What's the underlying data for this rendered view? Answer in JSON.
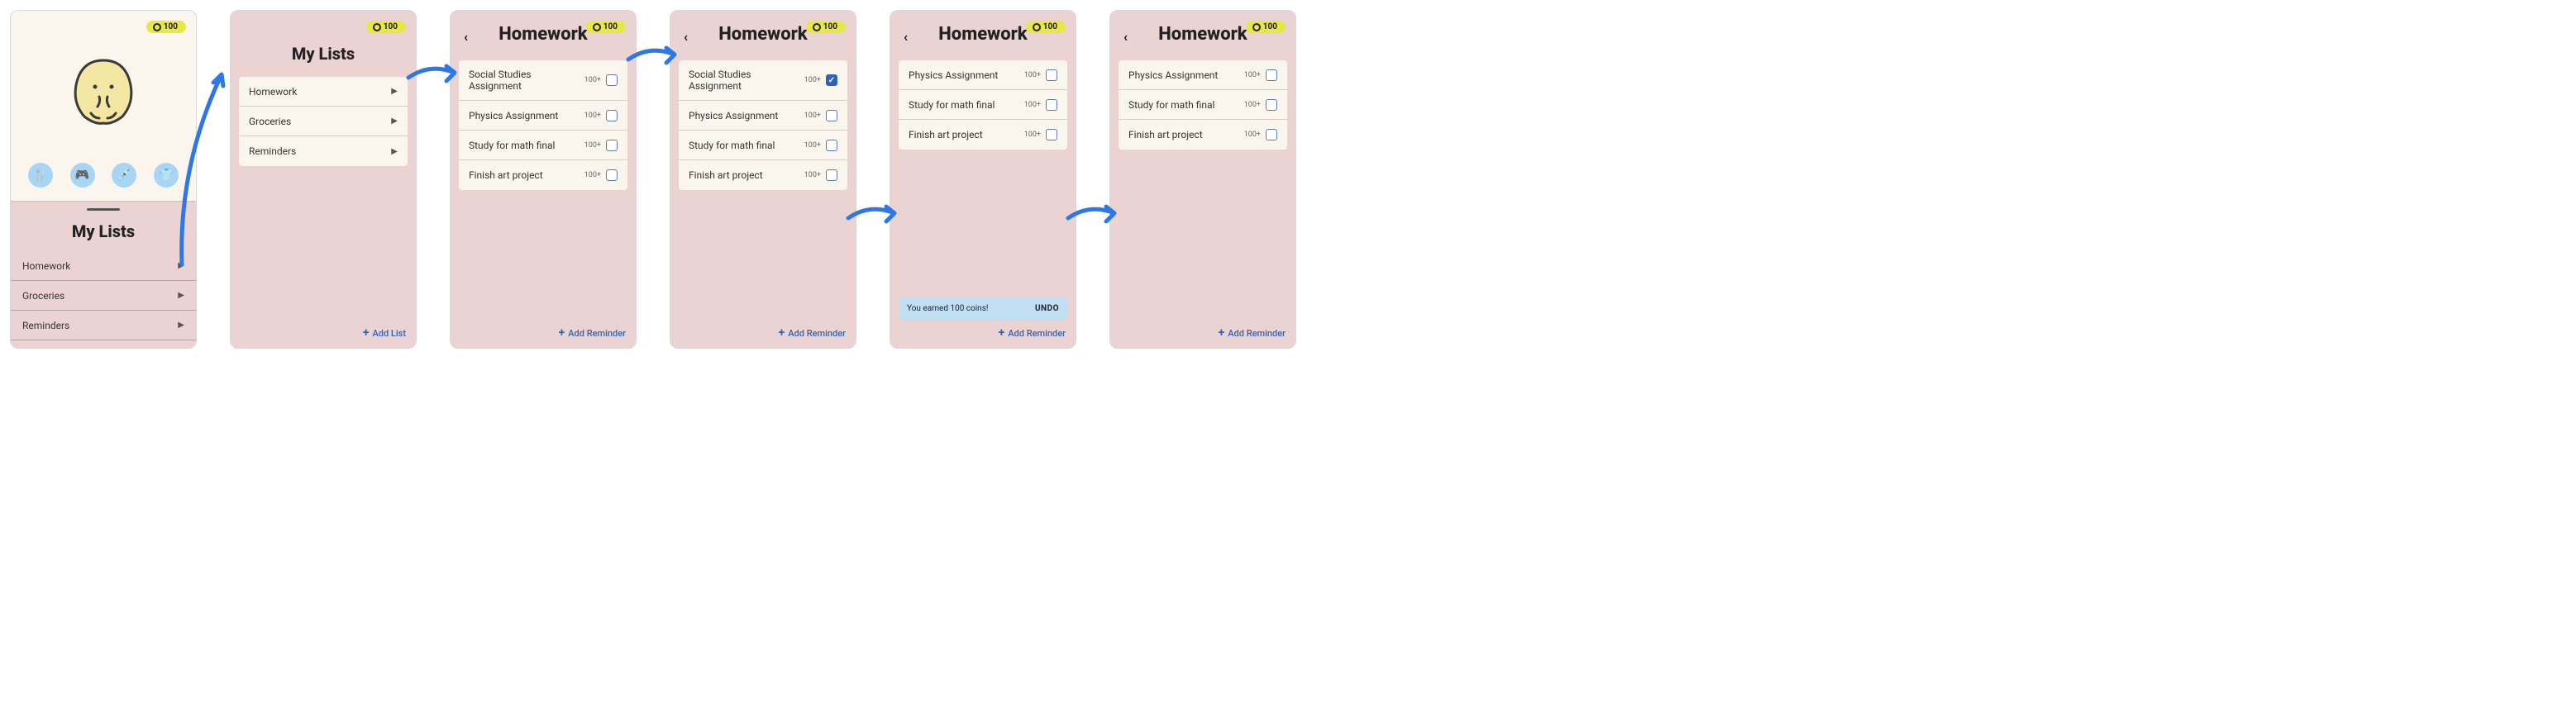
{
  "coin_value": "100",
  "mylists_title": "My Lists",
  "lists": [
    {
      "name": "Homework"
    },
    {
      "name": "Groceries"
    },
    {
      "name": "Reminders"
    }
  ],
  "add_list_label": "Add List",
  "homework_title": "Homework",
  "tasks_full": [
    {
      "name": "Social Studies Assignment",
      "reward": "100+"
    },
    {
      "name": "Physics Assignment",
      "reward": "100+"
    },
    {
      "name": "Study for math final",
      "reward": "100+"
    },
    {
      "name": "Finish art project",
      "reward": "100+"
    }
  ],
  "tasks_after": [
    {
      "name": "Physics Assignment",
      "reward": "100+"
    },
    {
      "name": "Study for math final",
      "reward": "100+"
    },
    {
      "name": "Finish art project",
      "reward": "100+"
    }
  ],
  "add_reminder_label": "Add Reminder",
  "toast_message": "You earned 100 coins!",
  "toast_action": "UNDO",
  "pet_icons": [
    {
      "name": "food-icon",
      "glyph": "🍴"
    },
    {
      "name": "game-icon",
      "glyph": "🎮"
    },
    {
      "name": "vaccine-icon",
      "glyph": "💉"
    },
    {
      "name": "shirt-icon",
      "glyph": "👕"
    }
  ]
}
